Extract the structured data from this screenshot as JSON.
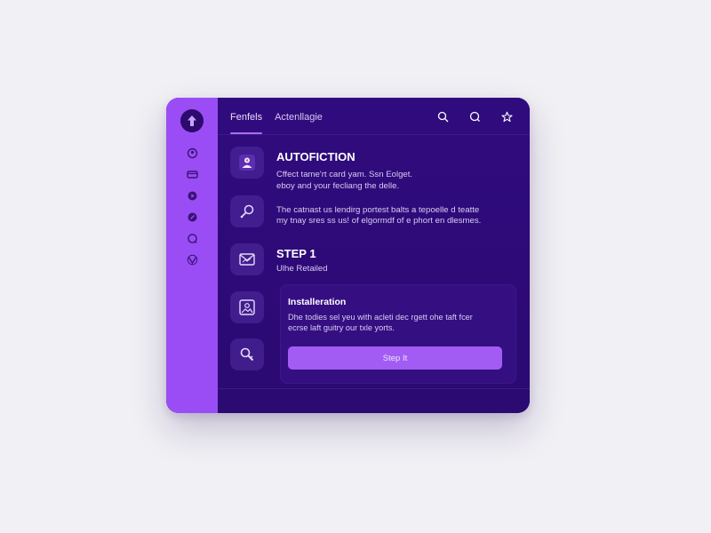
{
  "header": {
    "tabs": [
      {
        "label": "Fenfels",
        "active": true
      },
      {
        "label": "Actenllagie",
        "active": false
      }
    ],
    "actions": [
      "search-icon",
      "chat-icon",
      "star-icon"
    ]
  },
  "rail": {
    "logo": "arrow-up-logo",
    "items": [
      "user-circle-icon",
      "card-icon",
      "play-icon",
      "edit-icon",
      "bell-icon",
      "link-icon"
    ]
  },
  "sections": {
    "autofiction": {
      "title": "AUTOFICTION",
      "text_line1": "Cffect tame'rt card yam. Ssn Eolget.",
      "text_line2": "eboy and your fecliang the delle."
    },
    "info": {
      "text_line1": "The catnast us lendirg portest balts a tepoelle d teatte",
      "text_line2": "my tnay sres ss us! of elgormdf of e phort en dlesmes."
    },
    "step": {
      "title": "STEP 1",
      "subtitle": "Ulhe Retailed"
    },
    "installation": {
      "title": "Installeration",
      "text_line1": "Dhe todies sel yeu with acleti dec rgett ohe taft fcer",
      "text_line2": "ecrse laft guitry our txle yorts.",
      "button_label": "Step It"
    }
  },
  "colors": {
    "rail": "#9a4df4",
    "panel": "#2e0a7a",
    "accent": "#a25cf3",
    "background": "#f1f0f4"
  }
}
